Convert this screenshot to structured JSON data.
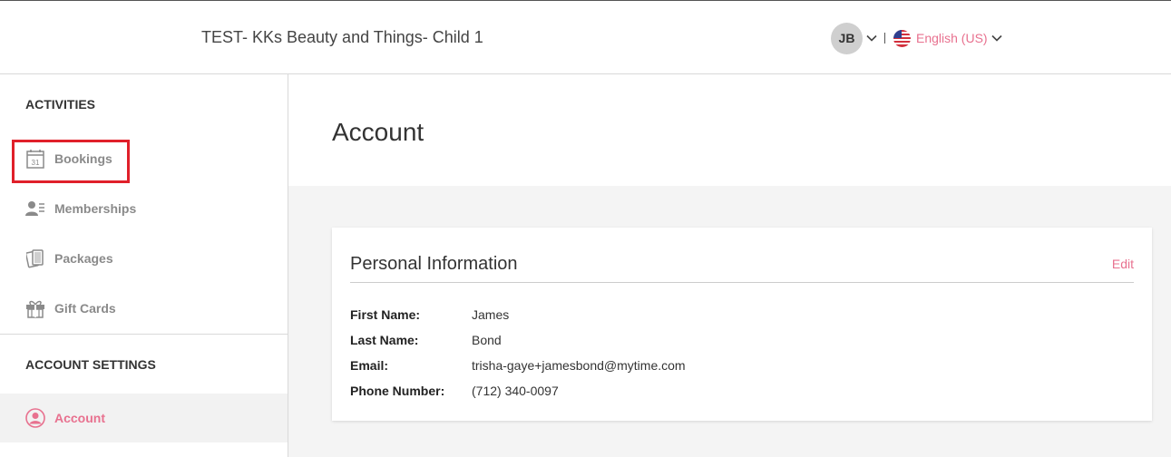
{
  "header": {
    "business_name": "TEST- KKs Beauty and Things- Child 1",
    "user_initials": "JB",
    "language": "English (US)"
  },
  "sidebar": {
    "activities_title": "ACTIVITIES",
    "activities": [
      {
        "label": "Bookings",
        "icon": "calendar-icon"
      },
      {
        "label": "Memberships",
        "icon": "membership-icon"
      },
      {
        "label": "Packages",
        "icon": "packages-icon"
      },
      {
        "label": "Gift Cards",
        "icon": "gift-icon"
      }
    ],
    "calendar_icon_text": "31",
    "settings_title": "ACCOUNT SETTINGS",
    "settings": [
      {
        "label": "Account",
        "icon": "user-circle-icon",
        "active": true
      }
    ]
  },
  "main": {
    "page_title": "Account",
    "card": {
      "title": "Personal Information",
      "edit_label": "Edit",
      "fields": [
        {
          "label": "First Name:",
          "value": "James"
        },
        {
          "label": "Last Name:",
          "value": "Bond"
        },
        {
          "label": "Email:",
          "value": "trisha-gaye+jamesbond@mytime.com"
        },
        {
          "label": "Phone Number:",
          "value": "(712) 340-0097"
        }
      ]
    }
  },
  "colors": {
    "accent": "#e8718f",
    "highlight": "#e0202a",
    "muted_text": "#8a8a8a",
    "background_gray": "#f4f4f4"
  }
}
